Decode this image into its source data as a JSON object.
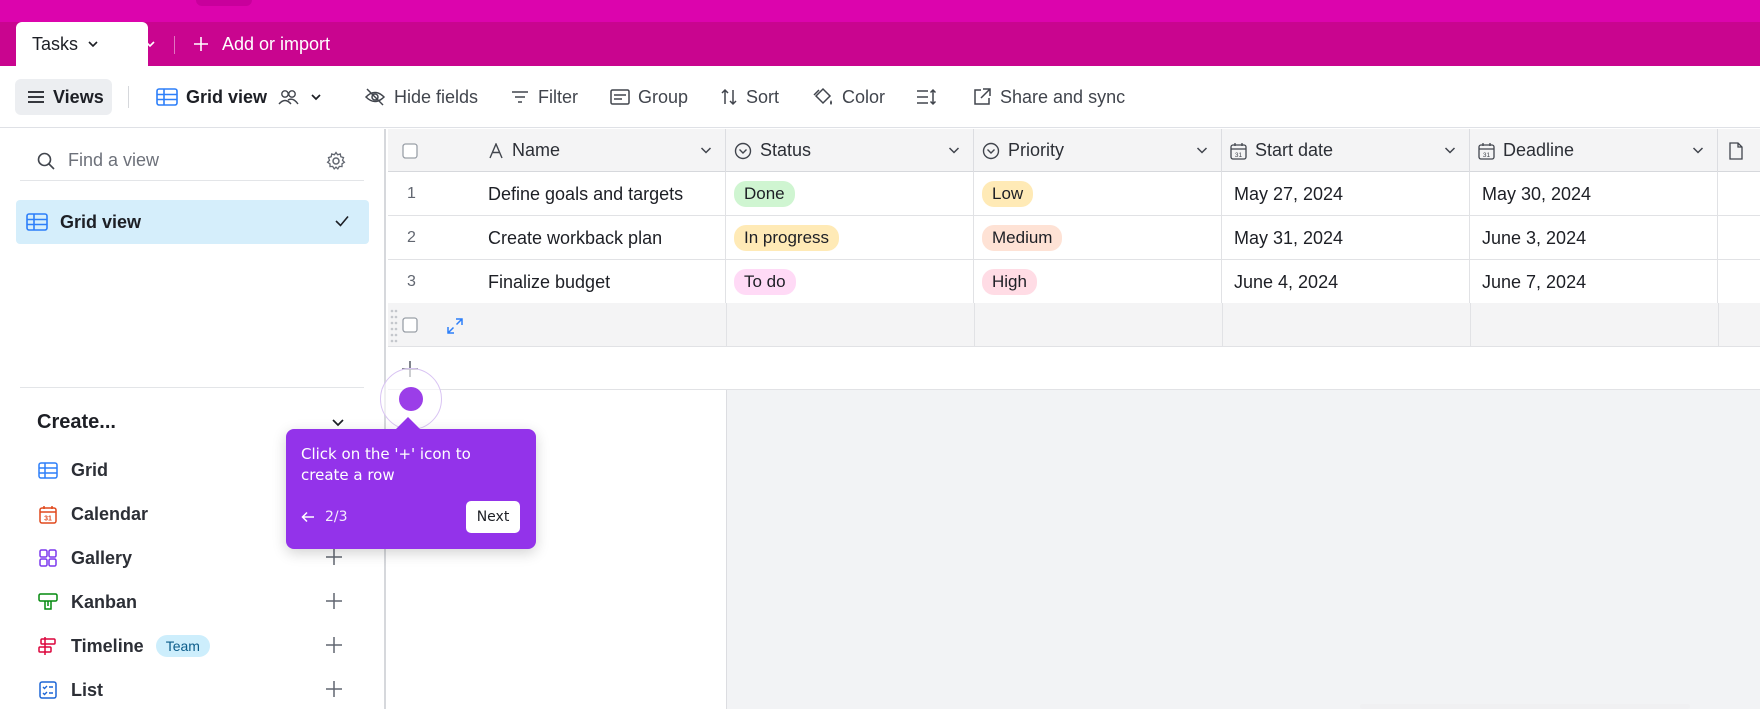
{
  "tabbar": {
    "active_tab": "Tasks",
    "add_import": "Add or import"
  },
  "toolbar": {
    "views": "Views",
    "grid_view": "Grid view",
    "hide_fields": "Hide fields",
    "filter": "Filter",
    "group": "Group",
    "sort": "Sort",
    "color": "Color",
    "share": "Share and sync"
  },
  "sidebar": {
    "search_placeholder": "Find a view",
    "views": [
      {
        "label": "Grid view",
        "selected": true
      }
    ],
    "create_heading": "Create...",
    "create_items": [
      {
        "label": "Grid",
        "icon": "grid-icon",
        "color": "#2d7ff9"
      },
      {
        "label": "Calendar",
        "icon": "calendar-icon",
        "color": "#e0491d"
      },
      {
        "label": "Gallery",
        "icon": "gallery-icon",
        "color": "#7c39ed"
      },
      {
        "label": "Kanban",
        "icon": "kanban-icon",
        "color": "#048a0e"
      },
      {
        "label": "Timeline",
        "icon": "timeline-icon",
        "color": "#dc043b",
        "badge": "Team"
      },
      {
        "label": "List",
        "icon": "list-icon",
        "color": "#1d66d6"
      }
    ]
  },
  "grid": {
    "columns": [
      "Name",
      "Status",
      "Priority",
      "Start date",
      "Deadline"
    ],
    "rows": [
      {
        "num": "1",
        "name": "Define goals and targets",
        "status": "Done",
        "priority": "Low",
        "start": "May 27, 2024",
        "deadline": "May 30, 2024"
      },
      {
        "num": "2",
        "name": "Create workback plan",
        "status": "In progress",
        "priority": "Medium",
        "start": "May 31, 2024",
        "deadline": "June 3, 2024"
      },
      {
        "num": "3",
        "name": "Finalize budget",
        "status": "To do",
        "priority": "High",
        "start": "June 4, 2024",
        "deadline": "June 7, 2024"
      }
    ],
    "status_colors": {
      "Done": "#cff5d1",
      "In progress": "#ffeab6",
      "To do": "#ffdaf6"
    },
    "priority_colors": {
      "Low": "#ffeab6",
      "Medium": "#fee2d5",
      "High": "#ffdce5"
    }
  },
  "tour": {
    "text": "Click on the '+' icon to create a row",
    "step": "2/3",
    "next": "Next"
  },
  "colors": {
    "brand": "#dc04ad",
    "tab_bar": "#c9058f",
    "tour_purple": "#9333ea"
  }
}
